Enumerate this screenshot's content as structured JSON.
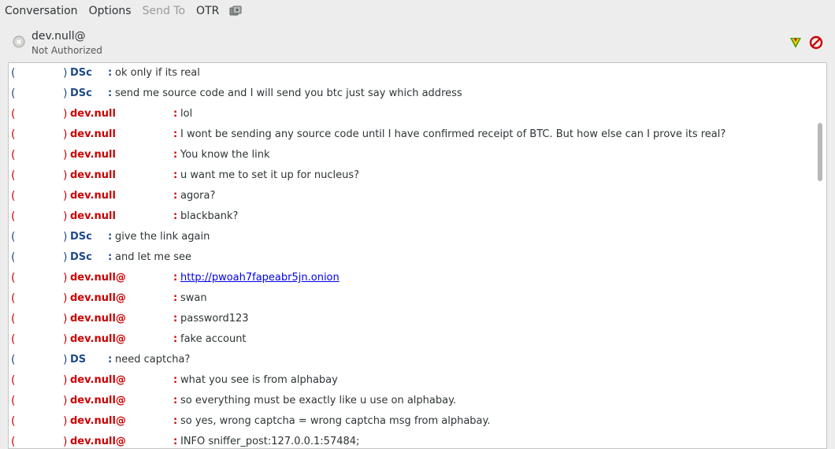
{
  "menubar": {
    "items": [
      {
        "label": "Conversation",
        "enabled": true
      },
      {
        "label": "Options",
        "enabled": true
      },
      {
        "label": "Send To",
        "enabled": false
      },
      {
        "label": "OTR",
        "enabled": true
      }
    ],
    "extra_icon": "plugin-icon"
  },
  "header": {
    "contact_name": "dev.null@",
    "contact_status": "Not Authorized",
    "status_icon": "offline-status-icon",
    "buttons": [
      "otr-verify-icon",
      "block-icon"
    ]
  },
  "colors": {
    "incoming": "#204a87",
    "outgoing": "#cc0000",
    "link": "#0000ee"
  },
  "messages": [
    {
      "dir": "in",
      "sender": "DSc",
      "text": "ok only if its real"
    },
    {
      "dir": "in",
      "sender": "DSc",
      "text": "send me source code and I will send you btc just say which address"
    },
    {
      "dir": "out",
      "sender": "dev.null",
      "text": "lol"
    },
    {
      "dir": "out",
      "sender": "dev.null",
      "text": "I wont be sending any source code until I have confirmed receipt of BTC. But how else can I prove its real?"
    },
    {
      "dir": "out",
      "sender": "dev.null",
      "text": "You know the link"
    },
    {
      "dir": "out",
      "sender": "dev.null",
      "text": "u want me to set it up for nucleus?"
    },
    {
      "dir": "out",
      "sender": "dev.null",
      "text": "agora?"
    },
    {
      "dir": "out",
      "sender": "dev.null",
      "text": "blackbank?"
    },
    {
      "dir": "in",
      "sender": "DSc",
      "text": "give the link again"
    },
    {
      "dir": "in",
      "sender": "DSc",
      "text": "and let me see"
    },
    {
      "dir": "out",
      "sender": "dev.null@",
      "text": "http://pwoah7fapeabr5jn.onion",
      "link": true
    },
    {
      "dir": "out",
      "sender": "dev.null@",
      "text": "swan"
    },
    {
      "dir": "out",
      "sender": "dev.null@",
      "text": "password123"
    },
    {
      "dir": "out",
      "sender": "dev.null@",
      "text": "fake account"
    },
    {
      "dir": "in",
      "sender": "DS",
      "text": "need captcha?"
    },
    {
      "dir": "out",
      "sender": "dev.null@",
      "text": "what you see is from alphabay"
    },
    {
      "dir": "out",
      "sender": "dev.null@",
      "text": "so everything must be exactly like u use on alphabay."
    },
    {
      "dir": "out",
      "sender": "dev.null@",
      "text": "so yes, wrong captcha = wrong captcha msg from alphabay."
    },
    {
      "dir": "out",
      "sender": "dev.null@",
      "text": "INFO     sniffer_post:127.0.0.1:57484;"
    }
  ]
}
